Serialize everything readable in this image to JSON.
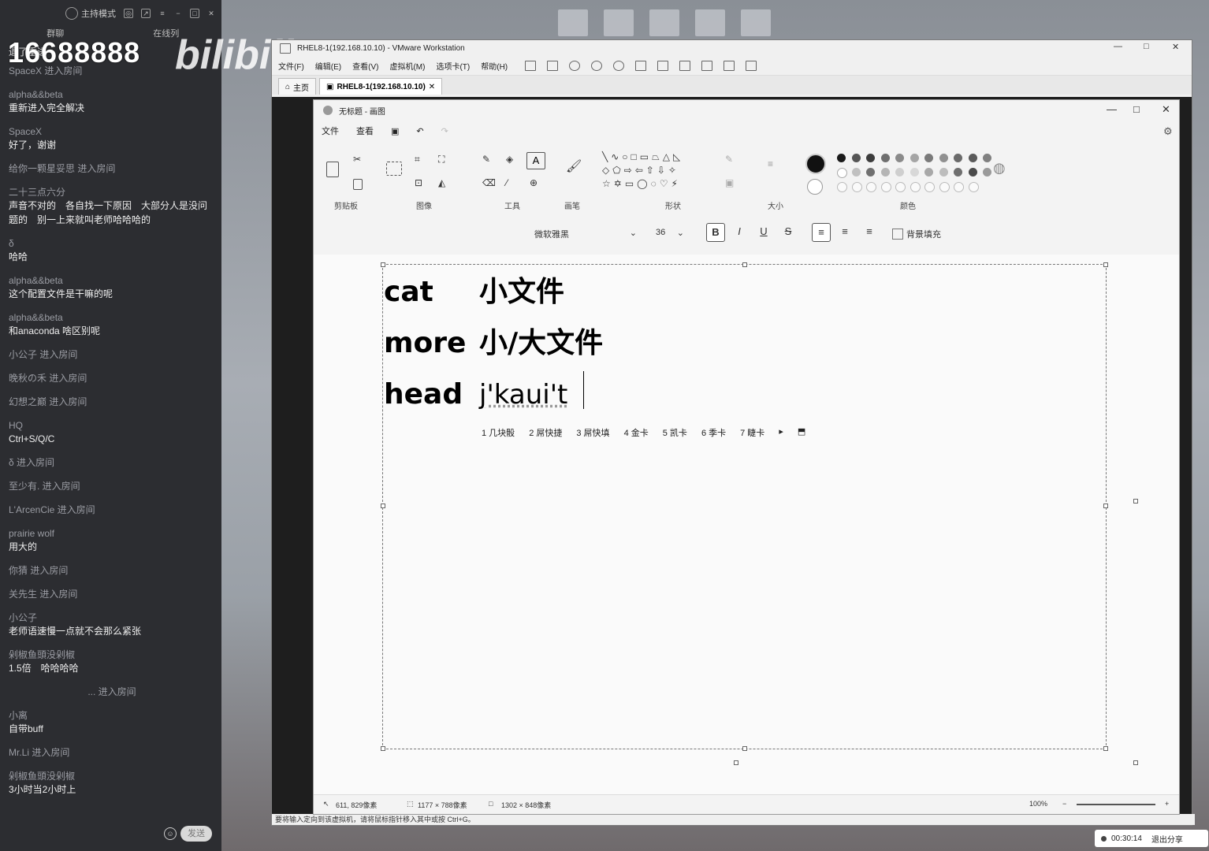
{
  "chat": {
    "host_mode": "主持模式",
    "tabs": [
      "群聊",
      "在线列"
    ],
    "watermark": "16688888",
    "logo": "bilibili",
    "first_partial": "退了重进",
    "messages": [
      {
        "type": "enter",
        "text": "SpaceX 进入房间"
      },
      {
        "type": "msg",
        "user": "alpha&&beta",
        "text": "重新进入完全解决"
      },
      {
        "type": "msg",
        "user": "SpaceX",
        "text": "好了，谢谢"
      },
      {
        "type": "enter",
        "text": "给你一颗星妥思 进入房间"
      },
      {
        "type": "msg",
        "user": "二十三点六分",
        "text": "声音不对的　各自找一下原因　大部分人是没问题的　别一上来就叫老师哈哈哈的"
      },
      {
        "type": "msg",
        "user": "δ",
        "text": "哈哈"
      },
      {
        "type": "msg",
        "user": "alpha&&beta",
        "text": "这个配置文件是干嘛的呢"
      },
      {
        "type": "msg",
        "user": "alpha&&beta",
        "text": "和anaconda 啥区别呢"
      },
      {
        "type": "enter",
        "text": "小公子 进入房间"
      },
      {
        "type": "enter",
        "text": "晚秋の禾 进入房间"
      },
      {
        "type": "enter",
        "text": "幻想之巅 进入房间"
      },
      {
        "type": "msg",
        "user": "HQ",
        "text": "Ctrl+S/Q/C"
      },
      {
        "type": "enter",
        "text": "δ 进入房间"
      },
      {
        "type": "enter",
        "text": "至少有. 进入房间"
      },
      {
        "type": "enter",
        "text": "L'ArcenCie 进入房间"
      },
      {
        "type": "msg",
        "user": "prairie wolf",
        "text": "用大的"
      },
      {
        "type": "enter",
        "text": "你猜 进入房间"
      },
      {
        "type": "enter",
        "text": "关先生 进入房间"
      },
      {
        "type": "msg",
        "user": "小公子",
        "text": "老师语速慢一点就不会那么紧张"
      },
      {
        "type": "msg",
        "user": "剁椒鱼頭没剁椒",
        "text": "1.5倍　哈哈哈哈"
      },
      {
        "type": "enter_center",
        "text": "... 进入房间"
      },
      {
        "type": "msg",
        "user": "小离",
        "text": "自带buff"
      },
      {
        "type": "enter",
        "text": "Mr.Li 进入房间"
      },
      {
        "type": "msg",
        "user": "剁椒鱼頭没剁椒",
        "text": "3小时当2小时上"
      }
    ],
    "send_label": "发送"
  },
  "vmware": {
    "title": "RHEL8-1(192.168.10.10) - VMware Workstation",
    "menu": [
      "文件(F)",
      "编辑(E)",
      "查看(V)",
      "虚拟机(M)",
      "选项卡(T)",
      "帮助(H)"
    ],
    "tabs": [
      "主页",
      "RHEL8-1(192.168.10.10)"
    ],
    "status": "要将输入定向到该虚拟机，请将鼠标指针移入其中或按 Ctrl+G。"
  },
  "paint": {
    "title": "无标题 - 画图",
    "menu": [
      "文件",
      "查看"
    ],
    "groups": [
      "剪贴板",
      "图像",
      "工具",
      "画笔",
      "形状",
      "大小",
      "颜色"
    ],
    "font_name": "微软雅黑",
    "font_size": "36",
    "bg_fill_label": "背景填充",
    "lines": [
      {
        "cmd": "cat",
        "desc": "小文件"
      },
      {
        "cmd": "more",
        "desc": "小/大文件"
      },
      {
        "cmd": "head",
        "desc": "j'kaui't"
      }
    ],
    "ime_candidates": [
      "1 几块骰",
      "2 屌快捷",
      "3 屌快填",
      "4 金卡",
      "5 凯卡",
      "6 季卡",
      "7 睫卡"
    ],
    "status": {
      "cursor": "611, 829像素",
      "selection": "1177 × 788像素",
      "canvas": "1302 × 848像素",
      "zoom": "100%"
    },
    "palette_row1": [
      "#1a1a1a",
      "#555555",
      "#3c3c3c",
      "#6e6e6e",
      "#8a8a8a",
      "#a5a5a5",
      "#7a7a7a",
      "#909090",
      "#6a6a6a",
      "#5a5a5a",
      "#808080"
    ],
    "palette_row2": [
      "#ffffff",
      "#c0c0c0",
      "#707070",
      "#b5b5b5",
      "#cfcfcf",
      "#d8d8d8",
      "#a8a8a8",
      "#bdbdbd",
      "#6f6f6f",
      "#4a4a4a",
      "#9a9a9a"
    ]
  },
  "share": {
    "timer": "00:30:14",
    "exit_label": "退出分享"
  }
}
